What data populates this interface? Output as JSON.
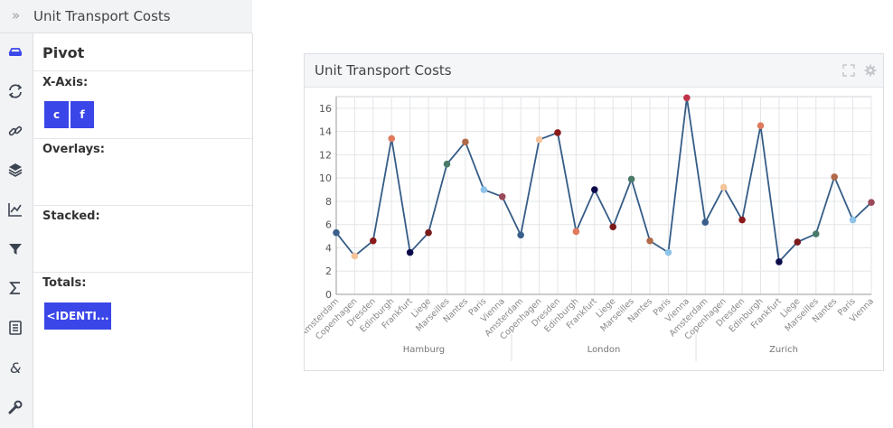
{
  "app": {
    "title": "Unit Transport Costs"
  },
  "sidebar": {
    "icons": [
      "car-icon",
      "refresh-icon",
      "link-icon",
      "layers-icon",
      "line-chart-icon",
      "filter-icon",
      "sigma-icon",
      "document-icon",
      "ampersand-icon",
      "wrench-icon"
    ]
  },
  "panel": {
    "title": "Pivot",
    "xaxis_label": "X-Axis:",
    "xaxis_buttons": [
      "c",
      "f"
    ],
    "overlays_label": "Overlays:",
    "stacked_label": "Stacked:",
    "totals_label": "Totals:",
    "totals_button": "<IDENTI..."
  },
  "chart_header": {
    "title": "Unit Transport Costs"
  },
  "chart_data": {
    "type": "line",
    "groups": [
      "Hamburg",
      "London",
      "Zurich"
    ],
    "categories": [
      "Amsterdam",
      "Copenhagen",
      "Dresden",
      "Edinburgh",
      "Frankfurt",
      "Liege",
      "Marseilles",
      "Nantes",
      "Paris",
      "Vienna"
    ],
    "x": [
      "Amsterdam",
      "Copenhagen",
      "Dresden",
      "Edinburgh",
      "Frankfurt",
      "Liege",
      "Marseilles",
      "Nantes",
      "Paris",
      "Vienna",
      "Amsterdam",
      "Copenhagen",
      "Dresden",
      "Edinburgh",
      "Frankfurt",
      "Liege",
      "Marseilles",
      "Nantes",
      "Paris",
      "Vienna",
      "Amsterdam",
      "Copenhagen",
      "Dresden",
      "Edinburgh",
      "Frankfurt",
      "Liege",
      "Marseilles",
      "Nantes",
      "Paris",
      "Vienna"
    ],
    "values": [
      5.3,
      3.3,
      4.6,
      13.4,
      3.6,
      5.3,
      11.2,
      13.1,
      9.0,
      8.4,
      5.1,
      13.3,
      13.9,
      5.4,
      9.0,
      5.8,
      9.9,
      4.6,
      3.6,
      16.9,
      6.2,
      9.2,
      6.4,
      14.5,
      2.8,
      4.5,
      5.2,
      10.1,
      6.4,
      7.9
    ],
    "point_colors": [
      "#3a5f8a",
      "#f4c49b",
      "#8b1a1a",
      "#e07a5f",
      "#0b0b4a",
      "#7a1a1a",
      "#4a7a6a",
      "#b06a4a",
      "#8ec3e8",
      "#9a4a5a",
      "#3a5f8a",
      "#f4c49b",
      "#8b1a1a",
      "#e07a5f",
      "#0b0b4a",
      "#7a1a1a",
      "#4a7a6a",
      "#b06a4a",
      "#8ec3e8",
      "#c0344a",
      "#3a5f8a",
      "#f4c49b",
      "#8b1a1a",
      "#e07a5f",
      "#0b0b4a",
      "#7a1a1a",
      "#4a7a6a",
      "#b06a4a",
      "#8ec3e8",
      "#9a4a5a"
    ],
    "line_color": "#355c86",
    "y_ticks": [
      0,
      2,
      4,
      6,
      8,
      10,
      12,
      14,
      16
    ],
    "ylim": [
      0,
      17
    ],
    "grid": true
  }
}
